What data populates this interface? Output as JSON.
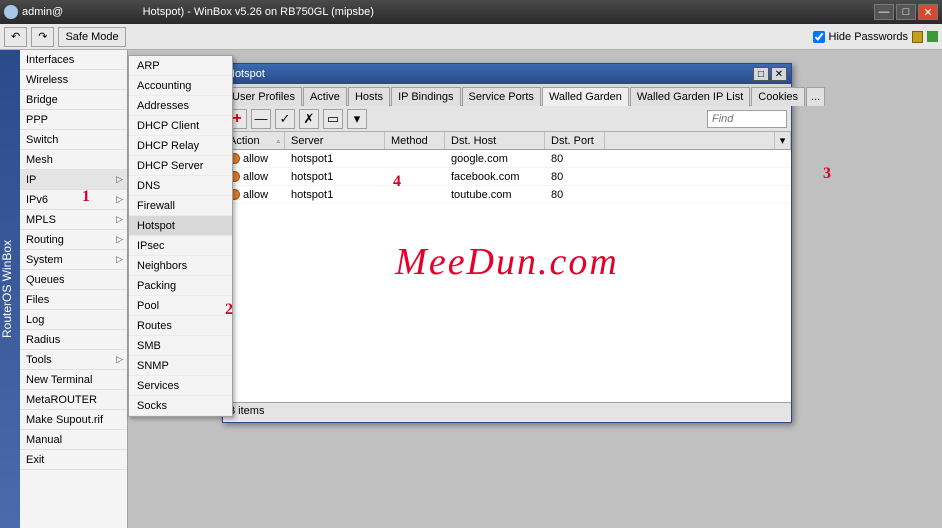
{
  "titlebar": {
    "user": "admin@",
    "title_suffix": "Hotspot) - WinBox v5.26 on RB750GL (mipsbe)"
  },
  "toolbar": {
    "undo_glyph": "↶",
    "redo_glyph": "↷",
    "safe_mode": "Safe Mode",
    "hide_passwords": "Hide Passwords"
  },
  "side_label": "RouterOS WinBox",
  "menu": {
    "items": [
      "Interfaces",
      "Wireless",
      "Bridge",
      "PPP",
      "Switch",
      "Mesh",
      "IP",
      "IPv6",
      "MPLS",
      "Routing",
      "System",
      "Queues",
      "Files",
      "Log",
      "Radius",
      "Tools",
      "New Terminal",
      "MetaROUTER",
      "Make Supout.rif",
      "Manual",
      "Exit"
    ],
    "has_sub": {
      "IP": true,
      "IPv6": true,
      "MPLS": true,
      "Routing": true,
      "System": true,
      "Tools": true
    }
  },
  "submenu": {
    "items": [
      "ARP",
      "Accounting",
      "Addresses",
      "DHCP Client",
      "DHCP Relay",
      "DHCP Server",
      "DNS",
      "Firewall",
      "Hotspot",
      "IPsec",
      "Neighbors",
      "Packing",
      "Pool",
      "Routes",
      "SMB",
      "SNMP",
      "Services",
      "Socks"
    ]
  },
  "childwin": {
    "title": "Hotspot",
    "tabs": [
      "User Profiles",
      "Active",
      "Hosts",
      "IP Bindings",
      "Service Ports",
      "Walled Garden",
      "Walled Garden IP List",
      "Cookies"
    ],
    "active_tab": "Walled Garden",
    "find_placeholder": "Find",
    "headers": {
      "action": "Action",
      "server": "Server",
      "method": "Method",
      "dsthost": "Dst. Host",
      "dstport": "Dst. Port"
    },
    "rows": [
      {
        "action": "allow",
        "server": "hotspot1",
        "method": "",
        "dsthost": "google.com",
        "dstport": "80"
      },
      {
        "action": "allow",
        "server": "hotspot1",
        "method": "",
        "dsthost": "facebook.com",
        "dstport": "80"
      },
      {
        "action": "allow",
        "server": "hotspot1",
        "method": "",
        "dsthost": "toutube.com",
        "dstport": "80"
      }
    ],
    "status": "3 items"
  },
  "watermark": "MeeDun.com",
  "annotations": {
    "a1": "1",
    "a2": "2",
    "a3": "3",
    "a4": "4"
  }
}
